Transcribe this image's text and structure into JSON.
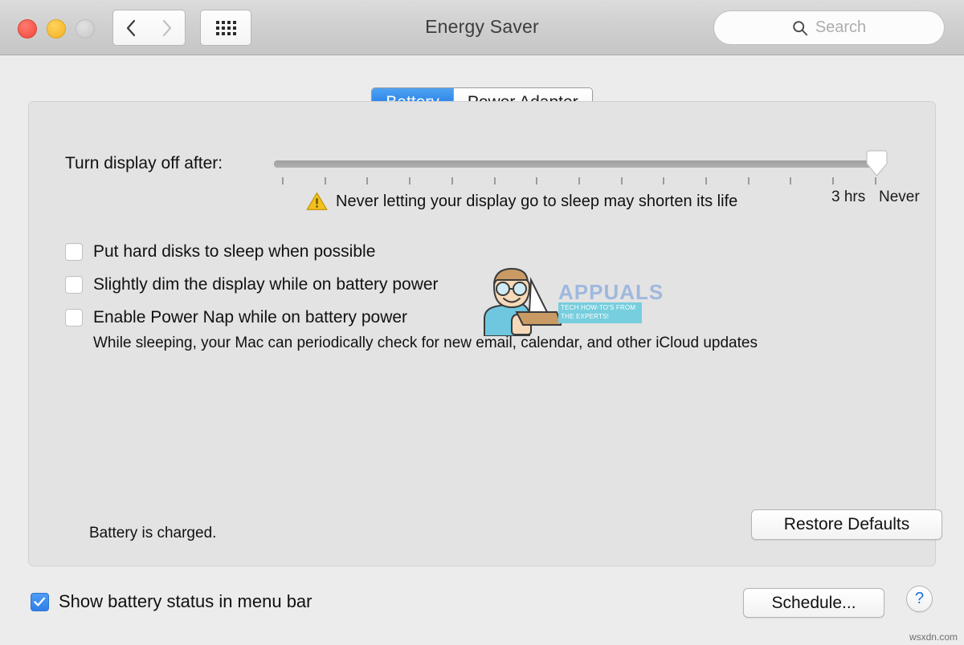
{
  "window": {
    "title": "Energy Saver",
    "traffic_lights": [
      {
        "name": "close",
        "color": "#f4564b"
      },
      {
        "name": "minimize",
        "color": "#f6bb32"
      },
      {
        "name": "zoom",
        "color": "#cfcfcf"
      }
    ],
    "nav": {
      "back_label": "‹",
      "forward_label": "›",
      "grid_label": "show-all"
    }
  },
  "search": {
    "placeholder": "Search",
    "value": "",
    "icon": "search-icon"
  },
  "tabs": [
    {
      "label": "Battery",
      "selected": true
    },
    {
      "label": "Power Adapter",
      "selected": false
    }
  ],
  "slider": {
    "label": "Turn display off after:",
    "value": "Never",
    "tick_count": 16,
    "tick_labels": [
      "3 hrs",
      "Never"
    ],
    "thumb_position_percent": 100
  },
  "warning": {
    "icon": "warning-triangle-icon",
    "text": "Never letting your display go to sleep may shorten its life",
    "color": "#f0b81c"
  },
  "checkboxes": [
    {
      "label": "Put hard disks to sleep when possible",
      "checked": false
    },
    {
      "label": "Slightly dim the display while on battery power",
      "checked": false
    },
    {
      "label": "Enable Power Nap while on battery power",
      "checked": false
    }
  ],
  "powernap_description": "While sleeping, your Mac can periodically check for new email, calendar, and other iCloud updates",
  "status": {
    "battery_text": "Battery is charged."
  },
  "buttons": {
    "restore_defaults": "Restore Defaults",
    "schedule": "Schedule...",
    "help": "?"
  },
  "footer": {
    "menubar_checkbox_label": "Show battery status in menu bar",
    "menubar_checkbox_checked": true
  },
  "watermark": {
    "brand": "APPUALS",
    "tagline": "TECH HOW-TO'S FROM THE EXPERTS!",
    "site": "wsxdn.com",
    "brand_color": "#9fb8de",
    "tagline_bg": "#76cede"
  },
  "colors": {
    "accent_blue": "#2d82e8",
    "window_bg": "#ececec",
    "panel_bg": "#e3e3e3",
    "warning_yellow": "#f0b81c"
  }
}
